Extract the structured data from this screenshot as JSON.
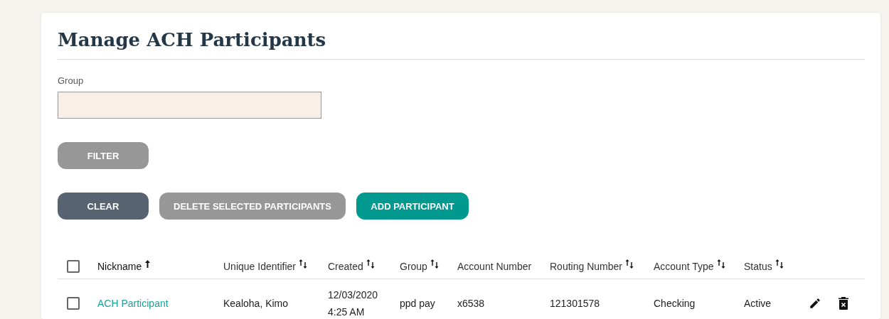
{
  "title": "Manage ACH Participants",
  "filter": {
    "label": "Group"
  },
  "filter_button": {
    "label": "FILTER",
    "disabled": true
  },
  "actions": [
    {
      "label": "CLEAR",
      "kind": "secondary",
      "disabled": false
    },
    {
      "label": "DELETE SELECTED PARTICIPANTS",
      "kind": "secondary",
      "disabled": true
    },
    {
      "label": "ADD PARTICIPANT",
      "kind": "primary",
      "disabled": false
    }
  ],
  "table": {
    "select_all": {
      "checked": false
    },
    "columns": [
      {
        "label": "Nickname",
        "sortable": true,
        "sorted_ascending": true
      },
      {
        "label": "Unique Identifier",
        "sortable": true,
        "sorted_ascending": false
      },
      {
        "label": "Created",
        "sortable": true,
        "sorted_ascending": false
      },
      {
        "label": "Group",
        "sortable": true,
        "sorted_ascending": false
      },
      {
        "label": "Account Number",
        "sortable": false,
        "sorted_ascending": false
      },
      {
        "label": "Routing Number",
        "sortable": true,
        "sorted_ascending": false
      },
      {
        "label": "Account Type",
        "sortable": true,
        "sorted_ascending": false
      },
      {
        "label": "Status",
        "sortable": true,
        "sorted_ascending": false
      }
    ],
    "rows": [
      {
        "checked": false,
        "cells": [
          "ACH Participant",
          "Kealoha, Kimo",
          "12/03/2020\n4:25 AM",
          "ppd pay",
          "x6538",
          "121301578",
          "Checking",
          "Active"
        ]
      }
    ]
  }
}
